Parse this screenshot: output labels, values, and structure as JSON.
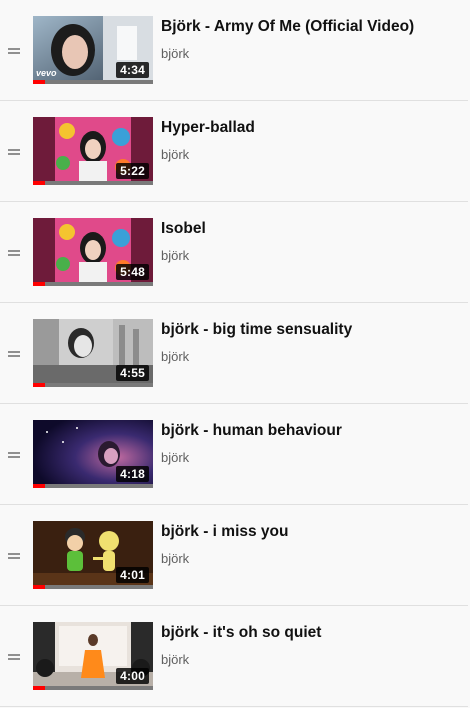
{
  "playlist": {
    "items": [
      {
        "title": "Björk - Army Of Me (Official Video)",
        "channel": "björk",
        "duration": "4:34",
        "progress_fraction": 0.1,
        "thumb": "army",
        "badge": "vevo"
      },
      {
        "title": "Hyper-ballad",
        "channel": "björk",
        "duration": "5:22",
        "progress_fraction": 0.1,
        "thumb": "portrait"
      },
      {
        "title": "Isobel",
        "channel": "björk",
        "duration": "5:48",
        "progress_fraction": 0.1,
        "thumb": "portrait"
      },
      {
        "title": "björk - big time sensuality",
        "channel": "björk",
        "duration": "4:55",
        "progress_fraction": 0.1,
        "thumb": "city"
      },
      {
        "title": "björk - human behaviour",
        "channel": "björk",
        "duration": "4:18",
        "progress_fraction": 0.1,
        "thumb": "night"
      },
      {
        "title": "björk - i miss you",
        "channel": "björk",
        "duration": "4:01",
        "progress_fraction": 0.1,
        "thumb": "cartoon"
      },
      {
        "title": "björk - it's oh so quiet",
        "channel": "björk",
        "duration": "4:00",
        "progress_fraction": 0.1,
        "thumb": "quiet"
      }
    ],
    "colors": {
      "progress": "#ff0000",
      "track": "#7a7a7a"
    },
    "icons": {
      "drag_handle": "drag-handle-icon"
    }
  }
}
